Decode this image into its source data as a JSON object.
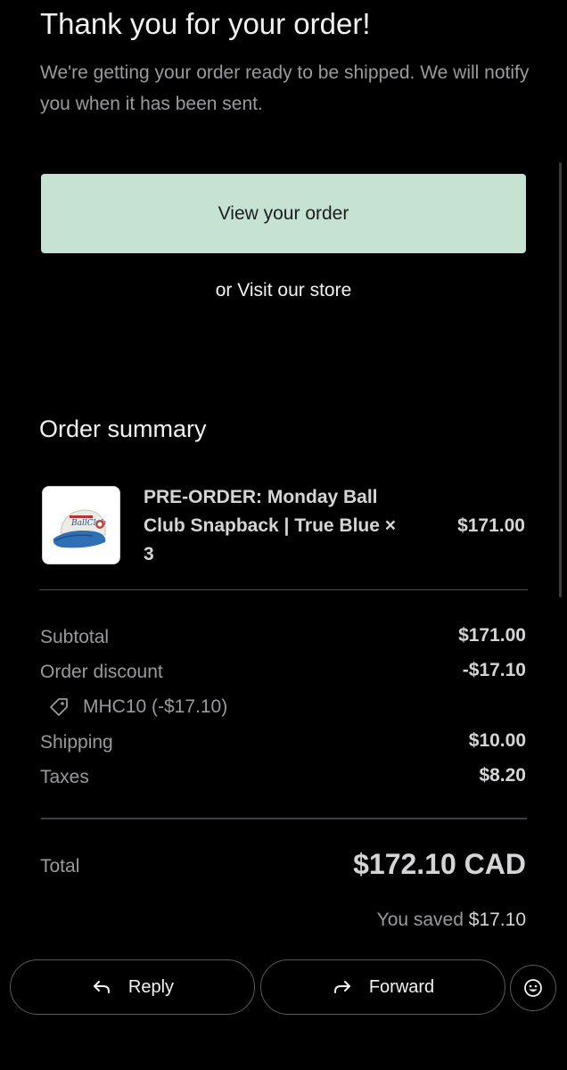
{
  "header": {
    "title": "Thank you for your order!",
    "message": "We're getting your order ready to be shipped. We will notify you when it has been sent."
  },
  "actions": {
    "view_order_label": "View your order",
    "or_text": "or",
    "visit_store_label": "Visit our store"
  },
  "order_summary": {
    "title": "Order summary",
    "item": {
      "name": "PRE-ORDER: Monday Ball Club Snapback | True Blue × 3",
      "price": "$171.00",
      "thumbnail_icon": "snapback-cap-image"
    },
    "rows": {
      "subtotal": {
        "label": "Subtotal",
        "value": "$171.00"
      },
      "discount": {
        "label": "Order discount",
        "value": "-$17.10"
      },
      "discount_code": "MHC10 (-$17.10)",
      "shipping": {
        "label": "Shipping",
        "value": "$10.00"
      },
      "taxes": {
        "label": "Taxes",
        "value": "$8.20"
      }
    },
    "total": {
      "label": "Total",
      "value": "$172.10 CAD"
    },
    "saved": {
      "label": "You saved",
      "amount": "$17.10"
    }
  },
  "mail_toolbar": {
    "reply_label": "Reply",
    "forward_label": "Forward",
    "emoji_icon": "smiley-icon"
  },
  "colors": {
    "background": "#000000",
    "button_bg": "#c6e2d3",
    "primary_text": "#f2f2f2",
    "secondary_text": "#9a9a9e"
  }
}
